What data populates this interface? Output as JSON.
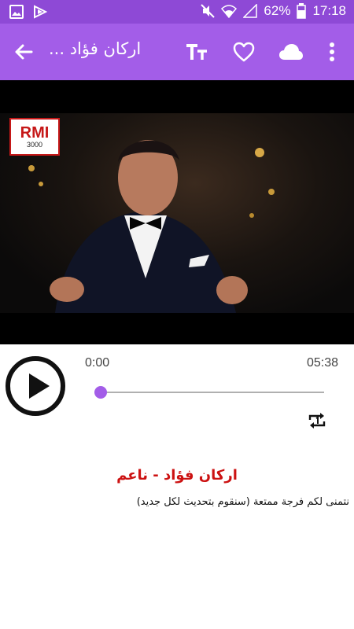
{
  "status_bar": {
    "battery_text": "62%",
    "time": "17:18",
    "icons": [
      "image-icon",
      "cast-icon",
      "mute-icon",
      "wifi-icon",
      "signal-icon",
      "battery-icon"
    ]
  },
  "app_bar": {
    "title": "اركان فؤاد ...",
    "icons": [
      "back-arrow-icon",
      "text-size-icon",
      "heart-icon",
      "cloud-icon",
      "more-vert-icon"
    ]
  },
  "video": {
    "logo_text": "RMI",
    "logo_subtext": "3000"
  },
  "player": {
    "current_time": "0:00",
    "total_time": "05:38",
    "progress": 0,
    "accent_color": "#a35de8"
  },
  "song": {
    "title": "اركان فؤاد - ناعم",
    "description": "نتمنى لكم فرجة ممتعة (سنقوم بتحديث لكل جديد)"
  }
}
